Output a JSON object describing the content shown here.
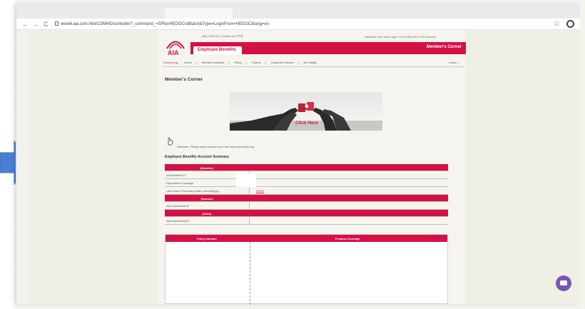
{
  "browser": {
    "url": "www6.aia.com.hk/eCOMHD/controller?_command_=SPfunHEDOCndBatch&Type=LoginFrom=HEDOC&lang=en",
    "nav_back": "←",
    "nav_forward": "→",
    "nav_reload": "C",
    "star": "☆"
  },
  "site": {
    "top_links": "AIA.COM.HK | Contact Us | 中文",
    "welcome": "Welcome  Your Last Login: 01/07/2023 09:17:00 Success",
    "product_tab": "Employee Benefits",
    "corner_title_top": "Member's Corner",
    "menu": {
      "region": "Hong Kong",
      "items": [
        "Home",
        "Member Activities",
        "Policy",
        "Claims",
        "Customer Service",
        "Aia Vitality"
      ],
      "close": "Close ×"
    },
    "page_title": "Member's Corner",
    "banner_cta": "Click Here",
    "welcome_message": "Welcome. Please select service from the menu bar at the top",
    "summary_title": "Employee Benefits Account Summary"
  },
  "summary": {
    "member_header": "(Member)",
    "rows_member": [
      {
        "label": "AIA Member ID",
        "value": ""
      },
      {
        "label": "Dependent Coverage",
        "value": ""
      },
      {
        "label": "Last Claim Processing Date (mm/dd/yyyy)",
        "value": "00/0/0"
      }
    ],
    "spouse_header": "(Spouse)",
    "rows_spouse": [
      {
        "label": "AIA Dependent ID",
        "value": ""
      }
    ],
    "child_header": "(Child)",
    "rows_child": [
      {
        "label": "AIA Dependent ID",
        "value": ""
      }
    ]
  },
  "policy_table": {
    "col1": "Policy Number",
    "col2": "Product Coverage"
  },
  "colors": {
    "brand_red": "#d31145",
    "arrow_blue": "#4a7fd6",
    "chat_purple": "#7b55b5"
  }
}
